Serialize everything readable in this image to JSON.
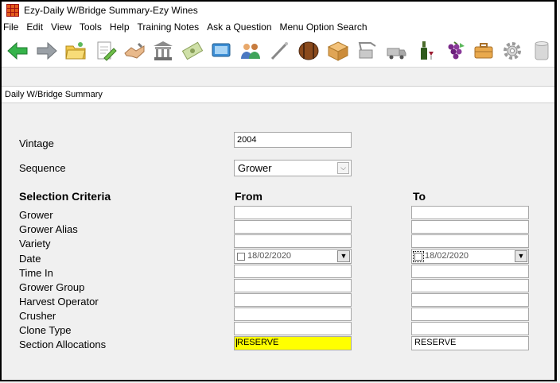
{
  "window": {
    "title": "Ezy-Daily W/Bridge Summary-Ezy Wines"
  },
  "menu": [
    "File",
    "Edit",
    "View",
    "Tools",
    "Help",
    "Training Notes",
    "Ask a Question",
    "Menu Option Search"
  ],
  "toolbar_icons": [
    "back-arrow-icon",
    "forward-arrow-icon",
    "folder-open-icon",
    "document-edit-icon",
    "handshake-icon",
    "bank-icon",
    "money-icon",
    "screen-icon",
    "people-icon",
    "wand-icon",
    "barrel-icon",
    "box-icon",
    "press-icon",
    "truck-icon",
    "wine-bottle-icon",
    "grapes-icon",
    "briefcase-icon",
    "gear-icon",
    "cylinder-icon"
  ],
  "tab": {
    "label": "Daily W/Bridge Summary"
  },
  "form": {
    "vintage": {
      "label": "Vintage",
      "value": "2004"
    },
    "sequence": {
      "label": "Sequence",
      "value": "Grower"
    },
    "selection_header": "Selection Criteria",
    "from_header": "From",
    "to_header": "To",
    "criteria": [
      "Grower",
      "Grower Alias",
      "Variety",
      "Date",
      "Time In",
      "Grower Group",
      "Harvest Operator",
      "Crusher",
      "Clone Type",
      "Section Allocations"
    ],
    "date_from": "18/02/2020",
    "date_to": "18/02/2020",
    "section_from": "RESERVE",
    "section_to": "RESERVE"
  },
  "colors": {
    "highlight": "#ffff00",
    "app_icon": "#a21212"
  }
}
